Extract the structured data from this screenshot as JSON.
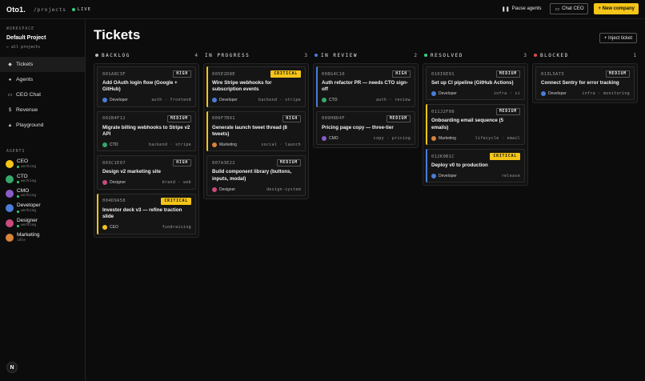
{
  "header": {
    "brand": "Oto1.",
    "path": "/projects",
    "live_label": "LIVE",
    "pause_label": "Pause agents",
    "chat_label": "Chat CEO",
    "new_label": "+ New company"
  },
  "sidebar": {
    "workspace_label": "WORKSPACE",
    "workspace_name": "Default Project",
    "back_label": "all projects",
    "nav": [
      {
        "label": "Tickets",
        "icon": "ticket-icon",
        "active": true
      },
      {
        "label": "Agents",
        "icon": "agents-icon"
      },
      {
        "label": "CEO Chat",
        "icon": "chat-icon"
      },
      {
        "label": "Revenue",
        "icon": "dollar-icon"
      },
      {
        "label": "Playground",
        "icon": "triangle-icon"
      }
    ],
    "agents_label": "AGENTS",
    "agents": [
      {
        "name": "CEO",
        "status": "working",
        "color": "#f5c518"
      },
      {
        "name": "CTO",
        "status": "working",
        "color": "#35a86a"
      },
      {
        "name": "CMO",
        "status": "working",
        "color": "#8a5cc9"
      },
      {
        "name": "Developer",
        "status": "working",
        "color": "#4a7dd8"
      },
      {
        "name": "Designer",
        "status": "working",
        "color": "#c94a7d"
      },
      {
        "name": "Marketing",
        "status": "idle",
        "color": "#d8843a"
      }
    ],
    "user_initial": "N"
  },
  "main": {
    "title": "Tickets",
    "inject_label": "+ Inject ticket",
    "columns": [
      {
        "title": "BACKLOG",
        "count": "4",
        "dot": "#bbbbbb",
        "cards": [
          {
            "id": "001A8C3F",
            "priority": "HIGH",
            "title": "Add OAuth login flow (Google + GitHub)",
            "assignee": "Developer",
            "assignee_color": "#4a7dd8",
            "tags": "auth · frontend"
          },
          {
            "id": "002B4F12",
            "priority": "MEDIUM",
            "title": "Migrate billing webhooks to Stripe v2 API",
            "assignee": "CTO",
            "assignee_color": "#35a86a",
            "tags": "backend · stripe"
          },
          {
            "id": "003C1E07",
            "priority": "HIGH",
            "title": "Design v2 marketing site",
            "assignee": "Designer",
            "assignee_color": "#c94a7d",
            "tags": "brand · web"
          },
          {
            "id": "004D9A58",
            "priority": "CRITICAL",
            "title": "Investor deck v3 — refine traction slide",
            "assignee": "CEO",
            "assignee_color": "#f5c518",
            "tags": "fundraising"
          }
        ]
      },
      {
        "title": "IN PROGRESS",
        "count": "3",
        "dot": "",
        "cards": [
          {
            "id": "005E2D8E",
            "priority": "CRITICAL",
            "title": "Wire Stripe webhooks for subscription events",
            "assignee": "Developer",
            "assignee_color": "#4a7dd8",
            "tags": "backend · stripe"
          },
          {
            "id": "006F7B91",
            "priority": "HIGH",
            "title": "Generate launch tweet thread (8 tweets)",
            "assignee": "Marketing",
            "assignee_color": "#d8843a",
            "tags": "social · launch"
          },
          {
            "id": "007A3E22",
            "priority": "MEDIUM",
            "title": "Build component library (buttons, inputs, modal)",
            "assignee": "Designer",
            "assignee_color": "#c94a7d",
            "tags": "design-system"
          }
        ]
      },
      {
        "title": "IN REVIEW",
        "count": "2",
        "dot": "#4a7dd8",
        "cards": [
          {
            "id": "008G4C10",
            "priority": "HIGH",
            "title": "Auth refactor PR — needs CTO sign-off",
            "assignee": "CTO",
            "assignee_color": "#35a86a",
            "tags": "auth · review"
          },
          {
            "id": "009H8D4F",
            "priority": "MEDIUM",
            "title": "Pricing page copy — three-tier",
            "assignee": "CMO",
            "assignee_color": "#8a5cc9",
            "tags": "copy · pricing"
          }
        ]
      },
      {
        "title": "RESOLVED",
        "count": "3",
        "dot": "#35d07f",
        "cards": [
          {
            "id": "010I6E91",
            "priority": "MEDIUM",
            "title": "Set up CI pipeline (GitHub Actions)",
            "assignee": "Developer",
            "assignee_color": "#4a7dd8",
            "tags": "infra · ci"
          },
          {
            "id": "011J2F08",
            "priority": "MEDIUM",
            "title": "Onboarding email sequence (5 emails)",
            "assignee": "Marketing",
            "assignee_color": "#d8843a",
            "tags": "lifecycle · email"
          },
          {
            "id": "012K9B1C",
            "priority": "CRITICAL",
            "title": "Deploy v0 to production",
            "assignee": "Developer",
            "assignee_color": "#4a7dd8",
            "tags": "release"
          }
        ]
      },
      {
        "title": "BLOCKED",
        "count": "1",
        "dot": "#e04848",
        "cards": [
          {
            "id": "013L5A73",
            "priority": "MEDIUM",
            "title": "Connect Sentry for error tracking",
            "assignee": "Developer",
            "assignee_color": "#4a7dd8",
            "tags": "infra · monitoring"
          }
        ]
      }
    ]
  }
}
